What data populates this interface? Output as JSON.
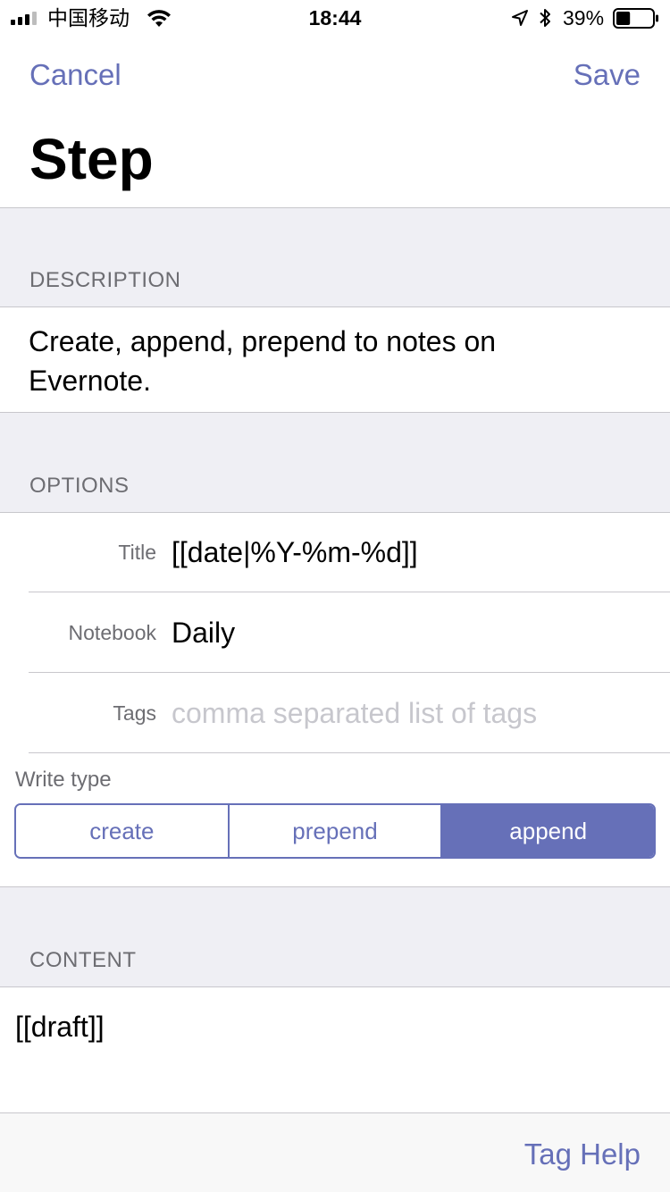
{
  "status_bar": {
    "carrier": "中国移动",
    "time": "18:44",
    "battery_percent": "39%",
    "battery_level": 0.39,
    "icons": [
      "signal-icon",
      "wifi-icon",
      "location-arrow-icon",
      "bluetooth-icon",
      "battery-icon"
    ]
  },
  "nav": {
    "cancel_label": "Cancel",
    "save_label": "Save",
    "title": "Step"
  },
  "description": {
    "header": "DESCRIPTION",
    "text": "Create, append, prepend to notes on Evernote."
  },
  "options": {
    "header": "OPTIONS",
    "title": {
      "label": "Title",
      "value": "[[date|%Y-%m-%d]]"
    },
    "notebook": {
      "label": "Notebook",
      "value": "Daily"
    },
    "tags": {
      "label": "Tags",
      "value": "",
      "placeholder": "comma separated list of tags"
    },
    "write_type": {
      "label": "Write type",
      "segments": [
        "create",
        "prepend",
        "append"
      ],
      "selected": "append"
    }
  },
  "content": {
    "header": "CONTENT",
    "value": "[[draft]]"
  },
  "toolbar": {
    "tag_help_label": "Tag Help"
  },
  "colors": {
    "accent": "#6670b8",
    "group_background": "#efeff4",
    "separator": "#c8c7cc",
    "secondary_text": "#6d6d72",
    "placeholder": "#c7c7cd"
  }
}
